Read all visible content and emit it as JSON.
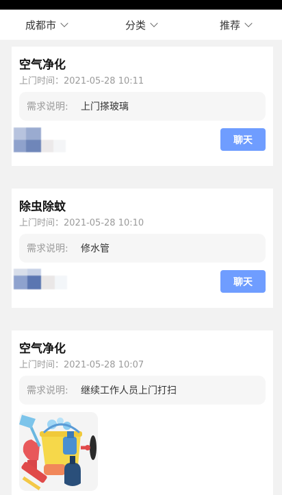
{
  "filters": [
    {
      "label": "成都市"
    },
    {
      "label": "分类"
    },
    {
      "label": "推荐"
    }
  ],
  "orders": [
    {
      "title": "空气净化",
      "time_label": "上门时间：",
      "time": "2021-05-28 10:11",
      "desc_label": "需求说明:",
      "desc": "上门搽玻璃",
      "action": "聊天"
    },
    {
      "title": "除虫除蚊",
      "time_label": "上门时间：",
      "time": "2021-05-28 10:10",
      "desc_label": "需求说明:",
      "desc": "修水管",
      "action": "聊天"
    },
    {
      "title": "空气净化",
      "time_label": "上门时间：",
      "time": "2021-05-28 10:07",
      "desc_label": "需求说明:",
      "desc": "继续工作人员上门打扫"
    }
  ],
  "colors": {
    "accent": "#6f9dff",
    "page_bg": "#f2f2f2"
  }
}
